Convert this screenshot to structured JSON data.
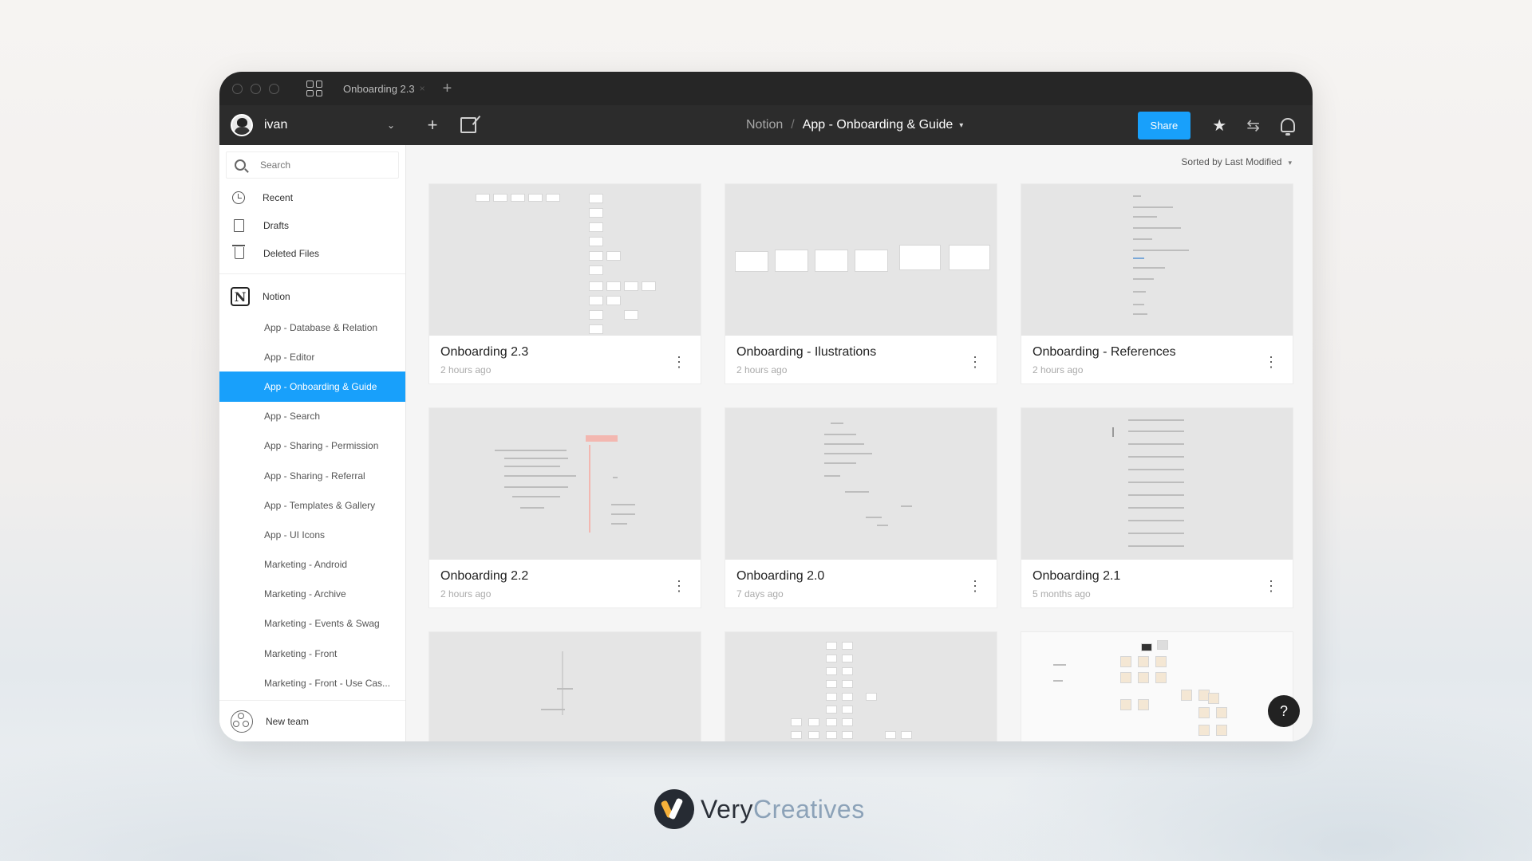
{
  "titlebar": {
    "tab_label": "Onboarding 2.3",
    "tab_close": "×",
    "new_tab": "+"
  },
  "toolbar": {
    "user_name": "ivan",
    "add_label": "+",
    "breadcrumb": {
      "team": "Notion",
      "separator": "/",
      "project": "App - Onboarding & Guide",
      "chevron": "▾"
    },
    "share_label": "Share",
    "star_icon": "★",
    "swap_icon": "⇆"
  },
  "sidebar": {
    "search_placeholder": "Search",
    "nav": [
      {
        "label": "Recent",
        "icon": "clock-icon"
      },
      {
        "label": "Drafts",
        "icon": "file-icon"
      },
      {
        "label": "Deleted Files",
        "icon": "trash-icon"
      }
    ],
    "team": {
      "name": "Notion",
      "logo": "N"
    },
    "projects": [
      "App - Database & Relation",
      "App - Editor",
      "App - Onboarding & Guide",
      "App - Search",
      "App - Sharing - Permission",
      "App - Sharing - Referral",
      "App - Templates & Gallery",
      "App - UI Icons",
      "Marketing - Android",
      "Marketing - Archive",
      "Marketing - Events & Swag",
      "Marketing - Front",
      "Marketing - Front - Use Cas..."
    ],
    "active_project": "App - Onboarding & Guide",
    "new_team_label": "New team"
  },
  "main": {
    "sort_label": "Sorted by Last Modified",
    "sort_chevron": "▾",
    "files": [
      {
        "title": "Onboarding 2.3",
        "time": "2 hours ago"
      },
      {
        "title": "Onboarding - Ilustrations",
        "time": "2 hours ago"
      },
      {
        "title": "Onboarding - References",
        "time": "2 hours ago"
      },
      {
        "title": "Onboarding 2.2",
        "time": "2 hours ago"
      },
      {
        "title": "Onboarding 2.0",
        "time": "7 days ago"
      },
      {
        "title": "Onboarding 2.1",
        "time": "5 months ago"
      }
    ],
    "kebab": "⋮",
    "help_label": "?"
  },
  "brand": {
    "part1": "Very",
    "part2": "Creatives"
  },
  "colors": {
    "accent": "#18a0fb",
    "titlebar": "#262626",
    "toolbar": "#2c2c2c",
    "brand_gold": "#f6b13a",
    "brand_blue": "#8ca2b8"
  }
}
